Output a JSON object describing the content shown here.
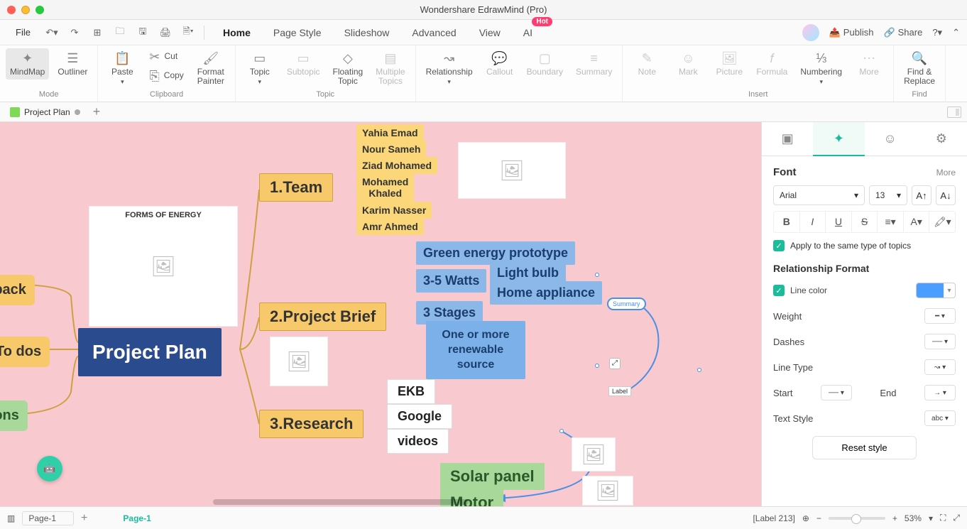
{
  "window": {
    "title": "Wondershare EdrawMind (Pro)"
  },
  "menu": {
    "file": "File",
    "tabs": [
      "Home",
      "Page Style",
      "Slideshow",
      "Advanced",
      "View",
      "AI"
    ],
    "active": "Home",
    "hot": "Hot",
    "publish": "Publish",
    "share": "Share"
  },
  "ribbon": {
    "mode": {
      "label": "Mode",
      "mindmap": "MindMap",
      "outliner": "Outliner"
    },
    "clipboard": {
      "label": "Clipboard",
      "paste": "Paste",
      "cut": "Cut",
      "copy": "Copy",
      "fp": "Format\nPainter"
    },
    "topic": {
      "label": "Topic",
      "topic": "Topic",
      "subtopic": "Subtopic",
      "floating": "Floating\nTopic",
      "multiple": "Multiple\nTopics"
    },
    "relation": {
      "relationship": "Relationship",
      "callout": "Callout",
      "boundary": "Boundary",
      "summary": "Summary"
    },
    "insert": {
      "label": "Insert",
      "note": "Note",
      "mark": "Mark",
      "picture": "Picture",
      "formula": "Formula",
      "numbering": "Numbering",
      "more": "More"
    },
    "find": {
      "label": "Find",
      "fr": "Find &\nReplace"
    }
  },
  "doc": {
    "name": "Project Plan",
    "add": "+"
  },
  "nodes": {
    "central": "Project Plan",
    "feedback": "edback",
    "todos": "To dos",
    "questions": "stions",
    "team": "1.Team",
    "team_members": [
      "Yahia Emad",
      "Nour Sameh",
      "Ziad Mohamed",
      "Mohamed\nKhaled",
      "Karim Nasser",
      "Amr Ahmed"
    ],
    "brief": "2.Project Brief",
    "brief_items": {
      "green": "Green energy prototype",
      "watts": "3-5 Watts",
      "bulb": "Light bulb",
      "home": "Home appliance",
      "stages": "3 Stages",
      "renew": "One or more renewable source"
    },
    "research": "3.Research",
    "research_items": [
      "EKB",
      "Google",
      "videos"
    ],
    "solar": "Solar panel",
    "motor": "Motor",
    "summary": "Summary",
    "label": "Label",
    "forms_title": "FORMS OF ENERGY"
  },
  "panel": {
    "font": "Font",
    "more": "More",
    "font_family": "Arial",
    "font_size": "13",
    "apply": "Apply to the same type of topics",
    "section": "Relationship Format",
    "line_color": "Line color",
    "weight": "Weight",
    "dashes": "Dashes",
    "line_type": "Line Type",
    "start": "Start",
    "end": "End",
    "text_style": "Text Style",
    "reset": "Reset style"
  },
  "status": {
    "page_sel": "Page-1",
    "page_name": "Page-1",
    "label": "[Label 213]",
    "zoom": "53%"
  }
}
